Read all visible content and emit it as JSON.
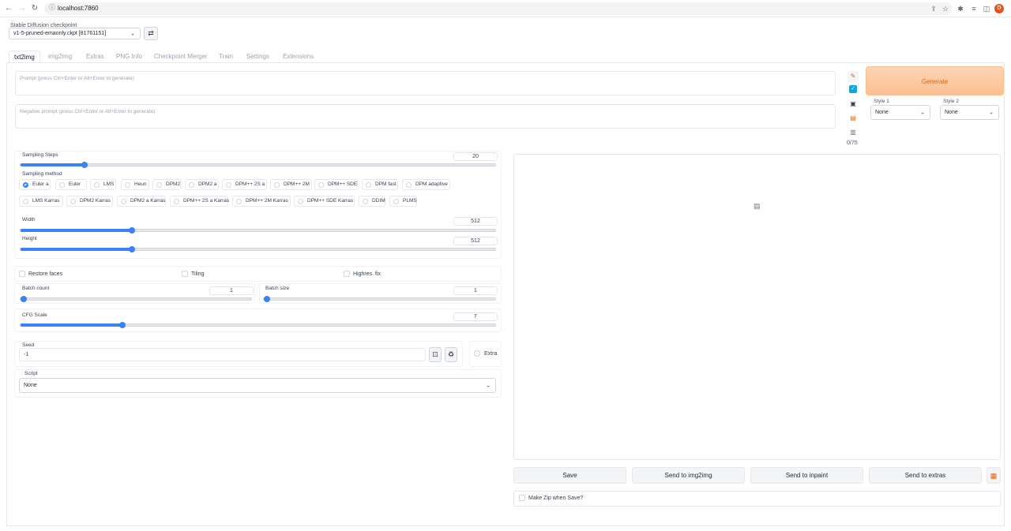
{
  "browser": {
    "url": "localhost:7860",
    "avatar_letter": "D"
  },
  "checkpoint": {
    "label": "Stable Diffusion checkpoint",
    "value": "v1-5-pruned-emaonly.ckpt [81761151]"
  },
  "tabs": [
    {
      "label": "txt2img",
      "active": true
    },
    {
      "label": "img2img"
    },
    {
      "label": "Extras"
    },
    {
      "label": "PNG Info"
    },
    {
      "label": "Checkpoint Merger"
    },
    {
      "label": "Train"
    },
    {
      "label": "Settings"
    },
    {
      "label": "Extensions"
    }
  ],
  "prompt": {
    "placeholder": "Prompt (press Ctrl+Enter or Alt+Enter to generate)"
  },
  "negative_prompt": {
    "placeholder": "Negative prompt (press Ctrl+Enter or Alt+Enter to generate)"
  },
  "token_count": "0/75",
  "generate_label": "Generate",
  "styles": {
    "style1_label": "Style 1",
    "style1_value": "None",
    "style2_label": "Style 2",
    "style2_value": "None"
  },
  "sampling_steps": {
    "label": "Sampling Steps",
    "value": "20",
    "fraction": 0.13
  },
  "sampling_method": {
    "label": "Sampling method",
    "options": [
      "Euler a",
      "Euler",
      "LMS",
      "Heun",
      "DPM2",
      "DPM2 a",
      "DPM++ 2S a",
      "DPM++ 2M",
      "DPM++ SDE",
      "DPM fast",
      "DPM adaptive",
      "LMS Karras",
      "DPM2 Karras",
      "DPM2 a Karras",
      "DPM++ 2S a Karras",
      "DPM++ 2M Karras",
      "DPM++ SDE Karras",
      "DDIM",
      "PLMS"
    ],
    "selected": "Euler a"
  },
  "width": {
    "label": "Width",
    "value": "512",
    "fraction": 0.23
  },
  "height": {
    "label": "Height",
    "value": "512",
    "fraction": 0.23
  },
  "checkboxes": {
    "restore_faces": "Restore faces",
    "tiling": "Tiling",
    "highres_fix": "Highres. fix"
  },
  "batch_count": {
    "label": "Batch count",
    "value": "1",
    "fraction": 0.0
  },
  "batch_size": {
    "label": "Batch size",
    "value": "1",
    "fraction": 0.0
  },
  "cfg_scale": {
    "label": "CFG Scale",
    "value": "7",
    "fraction": 0.21
  },
  "seed": {
    "label": "Seed",
    "value": "-1",
    "extra_label": "Extra"
  },
  "script": {
    "label": "Script",
    "value": "None"
  },
  "output_buttons": {
    "save": "Save",
    "send_img2img": "Send to img2img",
    "send_inpaint": "Send to inpaint",
    "send_extras": "Send to extras"
  },
  "make_zip_label": "Make Zip when Save?",
  "colors": {
    "accent": "#3b82f6",
    "generate_text": "#e4600f",
    "generate_bg": "#fbc08f"
  },
  "icons": [
    "back-icon",
    "forward-icon",
    "reload-icon",
    "lock-icon",
    "share-icon",
    "star-icon",
    "puzzle-icon",
    "list-icon",
    "panel-icon",
    "refresh-icon",
    "paste-icon",
    "check-icon",
    "save-icon",
    "clipboard-icon",
    "trash-icon",
    "image-placeholder-icon",
    "dice-icon",
    "recycle-icon",
    "folder-icon"
  ]
}
